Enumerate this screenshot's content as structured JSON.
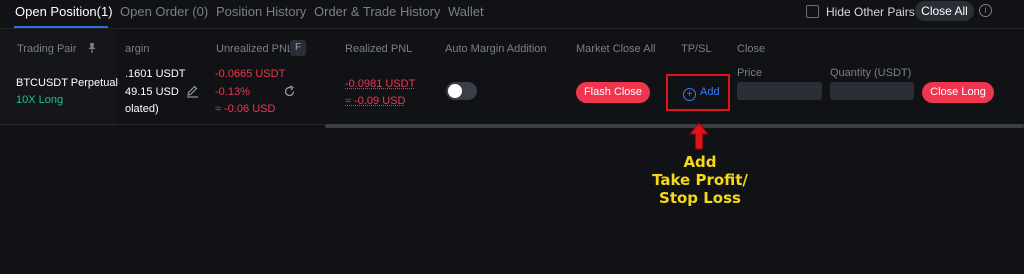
{
  "tabs": [
    {
      "label": "Open Position(1)",
      "active": true
    },
    {
      "label": "Open Order (0)"
    },
    {
      "label": "Position History"
    },
    {
      "label": "Order & Trade History"
    },
    {
      "label": "Wallet"
    }
  ],
  "toolbar": {
    "hide_other_pairs": "Hide Other Pairs",
    "hide_other_pairs_checked": false,
    "close_all": "Close All",
    "info_glyph": "i"
  },
  "columns": {
    "trading_pair": "Trading Pair",
    "margin": "argin",
    "unrealized_pnl": "Unrealized PNL",
    "unrealized_badge": "F",
    "realized_pnl": "Realized PNL",
    "auto_margin": "Auto Margin Addition",
    "market_close_all": "Market Close All",
    "tpsl": "TP/SL",
    "close": "Close"
  },
  "position": {
    "pair": "BTCUSDT Perpetual",
    "leverage": "10X Long",
    "margin_line1": ".1601 USDT",
    "margin_line2": "49.15 USD",
    "margin_line3": "olated)",
    "unrealized_line1": "-0.0665 USDT",
    "unrealized_line2": "-0.13%",
    "unrealized_line3": "≈ -0.06 USD",
    "realized_line1": "-0.0981 USDT",
    "realized_line2": "≈ -0.09 USD",
    "auto_margin_enabled": false,
    "flash_close": "Flash Close",
    "tpsl_add": "Add",
    "tpsl_plus": "+",
    "price_label": "Price",
    "quantity_label": "Quantity (USDT)",
    "close_long": "Close Long"
  },
  "annotation": {
    "line1": "Add",
    "line2": "Take Profit/",
    "line3": "Stop Loss"
  },
  "colors": {
    "accent_blue": "#2f6ddf",
    "long_green": "#16c784",
    "sell_red": "#f0364f",
    "highlight_red": "#e0121b",
    "annotation_yellow": "#f5d916"
  },
  "icons": {
    "pin": "pin-icon",
    "edit": "edit-icon",
    "share": "share-icon",
    "plus_circle": "plus-circle-icon",
    "info": "info-icon",
    "arrow": "arrow-up-icon"
  }
}
